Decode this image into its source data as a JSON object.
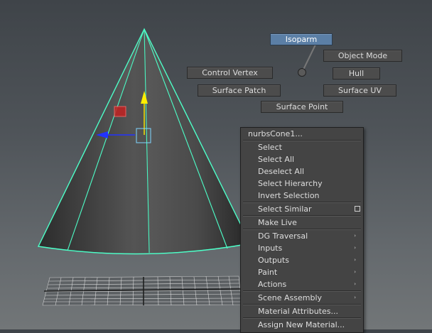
{
  "marking_menu": {
    "highlighted": "Isoparm",
    "items": {
      "isoparm": "Isoparm",
      "object_mode": "Object Mode",
      "control_vertex": "Control Vertex",
      "hull": "Hull",
      "surface_patch": "Surface Patch",
      "surface_uv": "Surface UV",
      "surface_point": "Surface Point"
    }
  },
  "context_menu": {
    "title": "nurbsCone1...",
    "items": [
      {
        "label": "Select"
      },
      {
        "label": "Select All"
      },
      {
        "label": "Deselect All"
      },
      {
        "label": "Select Hierarchy"
      },
      {
        "label": "Invert Selection"
      },
      {
        "label": "Select Similar",
        "option_box": true
      },
      {
        "label": "Make Live"
      },
      {
        "label": "DG Traversal",
        "submenu": true
      },
      {
        "label": "Inputs",
        "submenu": true
      },
      {
        "label": "Outputs",
        "submenu": true
      },
      {
        "label": "Paint",
        "submenu": true
      },
      {
        "label": "Actions",
        "submenu": true
      },
      {
        "label": "Scene Assembly",
        "submenu": true
      },
      {
        "label": "Material Attributes..."
      },
      {
        "label": "Assign New Material..."
      }
    ],
    "submenu_arrow": "›"
  },
  "colors": {
    "wireframe": "#4dffc8",
    "cone_shade_light": "#5f5f5f",
    "cone_shade_dark": "#2c2c2c",
    "manipulator_y": "#ffee00",
    "manipulator_x": "#2233ff",
    "manipulator_center": "#7fd6ff",
    "highlight": "#5b7fa6"
  },
  "icons": [
    "move-manipulator-icon",
    "option-box-icon",
    "submenu-arrow-icon"
  ]
}
